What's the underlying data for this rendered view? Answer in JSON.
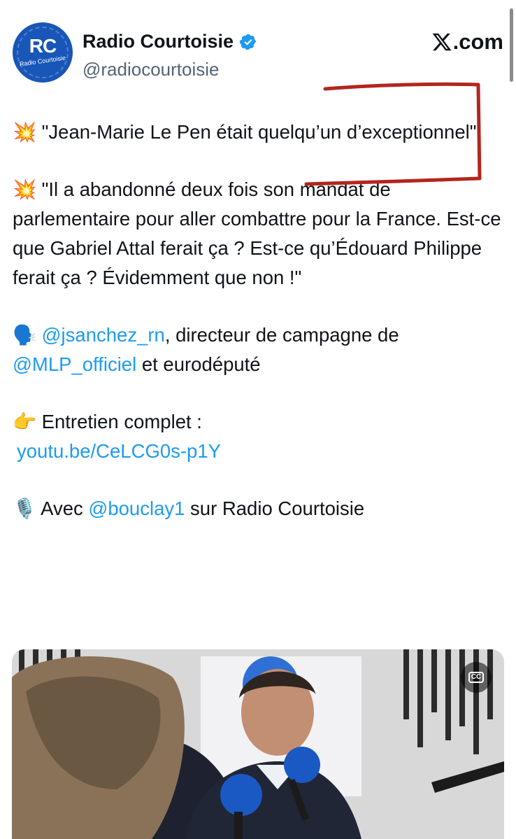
{
  "header": {
    "avatar": {
      "initials": "RC",
      "subtitle": "Radio Courtoisie"
    },
    "display_name": "Radio Courtoisie",
    "verified_icon": "verified-badge-icon",
    "handle": "@radiocourtoisie",
    "source": "X.com",
    "source_icon": "x-logo-icon"
  },
  "tweet": {
    "p1": {
      "emoji": "💥",
      "text": "\"Jean-Marie Le Pen était quelqu’un d’exceptionnel\""
    },
    "p2": {
      "emoji": "💥",
      "text": "\"Il a abandonné deux fois son mandat de parlementaire pour aller combattre pour la France. Est-ce que Gabriel Attal ferait ça ? Est-ce qu’Édouard Philippe ferait ça ? Évidemment que non !\""
    },
    "p3": {
      "emoji": "🗣️",
      "mention1": "@jsanchez_rn",
      "text1": ", directeur de campagne de",
      "mention2": "@MLP_officiel",
      "text2": " et eurodéputé"
    },
    "p4": {
      "emoji": "👉",
      "text": "Entretien complet :",
      "link": "youtu.be/CeLCG0s-p1Y"
    },
    "p5": {
      "emoji": "🎙️",
      "text1": "Avec ",
      "mention": "@bouclay1",
      "text2": " sur Radio Courtoisie"
    }
  },
  "annotation": {
    "color": "#b3261e"
  },
  "media": {
    "cc_label": "CC",
    "cc_icon": "closed-captions-icon"
  },
  "colors": {
    "link": "#1d9bf0",
    "text": "#0f1419",
    "muted": "#536471",
    "brand": "#1856b8"
  }
}
